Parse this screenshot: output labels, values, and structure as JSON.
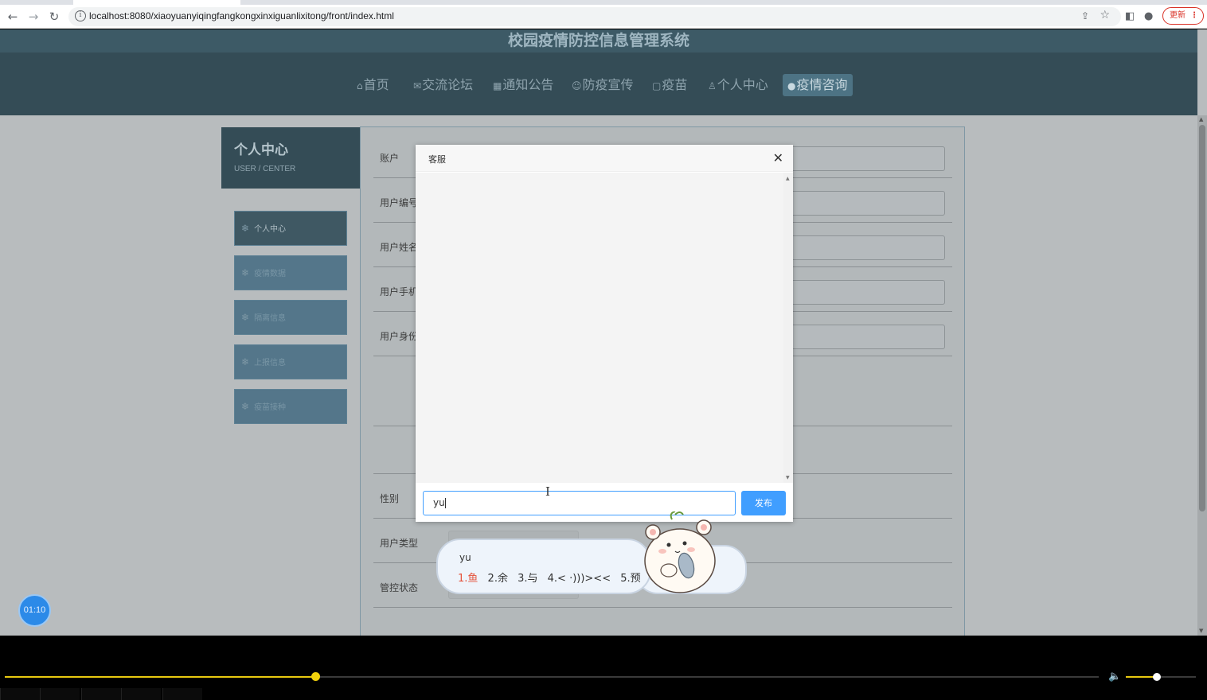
{
  "browser": {
    "url": "localhost:8080/xiaoyuanyiqingfangkongxinxiguanlixitong/front/index.html",
    "update_label": "更新"
  },
  "site": {
    "title": "校园疫情防控信息管理系统",
    "nav": [
      {
        "icon": "⌂",
        "label": "首页"
      },
      {
        "icon": "✉",
        "label": "交流论坛"
      },
      {
        "icon": "▦",
        "label": "通知公告"
      },
      {
        "icon": "☺",
        "label": "防疫宣传"
      },
      {
        "icon": "▢",
        "label": "疫苗"
      },
      {
        "icon": "♙",
        "label": "个人中心"
      },
      {
        "icon": "●",
        "label": "疫情咨询"
      }
    ]
  },
  "usercard": {
    "title": "个人中心",
    "subtitle": "USER / CENTER"
  },
  "sidebar": [
    {
      "label": "个人中心"
    },
    {
      "label": "疫情数据"
    },
    {
      "label": "隔离信息"
    },
    {
      "label": "上报信息"
    },
    {
      "label": "疫苗接种"
    }
  ],
  "form": {
    "labels": [
      "账户",
      "用户编号",
      "用户姓名",
      "用户手机",
      "用户身份",
      "性别",
      "用户类型",
      "管控状态"
    ]
  },
  "modal": {
    "title": "客服",
    "input_value": "yu",
    "send_label": "发布"
  },
  "ime": {
    "composition": "yu",
    "candidates": [
      "1.鱼",
      "2.余",
      "3.与",
      "4.< ·)))><<",
      "5.预"
    ]
  },
  "timer": "01:10",
  "player": {
    "progress": 0.284,
    "volume": 0.44
  }
}
